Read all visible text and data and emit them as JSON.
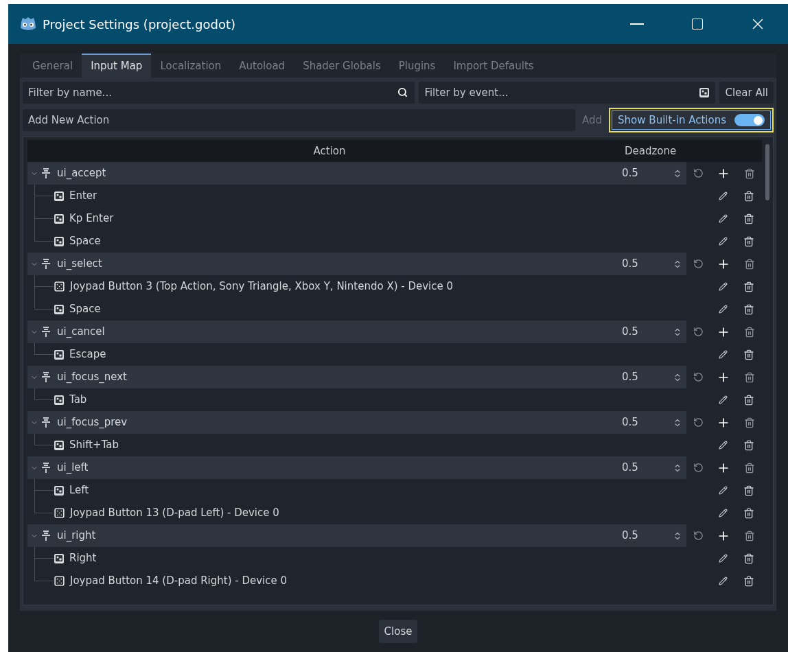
{
  "window": {
    "title": "Project Settings (project.godot)"
  },
  "tabs": [
    {
      "label": "General",
      "selected": false
    },
    {
      "label": "Input Map",
      "selected": true
    },
    {
      "label": "Localization",
      "selected": false
    },
    {
      "label": "Autoload",
      "selected": false
    },
    {
      "label": "Shader Globals",
      "selected": false
    },
    {
      "label": "Plugins",
      "selected": false
    },
    {
      "label": "Import Defaults",
      "selected": false
    }
  ],
  "filter_name": {
    "placeholder": "Filter by name..."
  },
  "filter_event": {
    "placeholder": "Filter by event..."
  },
  "clear_all": "Clear All",
  "add_action": {
    "placeholder": "Add New Action",
    "button": "Add",
    "button_disabled": true
  },
  "show_builtin": {
    "label": "Show Built-in Actions",
    "on": true
  },
  "table": {
    "columns": [
      "Action",
      "Deadzone"
    ],
    "actions": [
      {
        "name": "ui_accept",
        "deadzone": "0.5",
        "expanded": true,
        "events": [
          {
            "kind": "key",
            "label": "Enter"
          },
          {
            "kind": "key",
            "label": "Kp Enter"
          },
          {
            "kind": "key",
            "label": "Space"
          }
        ]
      },
      {
        "name": "ui_select",
        "deadzone": "0.5",
        "expanded": true,
        "events": [
          {
            "kind": "joypad",
            "label": "Joypad Button 3 (Top Action, Sony Triangle, Xbox Y, Nintendo X) - Device 0"
          },
          {
            "kind": "key",
            "label": "Space"
          }
        ]
      },
      {
        "name": "ui_cancel",
        "deadzone": "0.5",
        "expanded": true,
        "events": [
          {
            "kind": "key",
            "label": "Escape"
          }
        ]
      },
      {
        "name": "ui_focus_next",
        "deadzone": "0.5",
        "expanded": true,
        "events": [
          {
            "kind": "key",
            "label": "Tab"
          }
        ]
      },
      {
        "name": "ui_focus_prev",
        "deadzone": "0.5",
        "expanded": true,
        "events": [
          {
            "kind": "key",
            "label": "Shift+Tab"
          }
        ]
      },
      {
        "name": "ui_left",
        "deadzone": "0.5",
        "expanded": true,
        "events": [
          {
            "kind": "key",
            "label": "Left"
          },
          {
            "kind": "joypad",
            "label": "Joypad Button 13 (D-pad Left) - Device 0"
          }
        ]
      },
      {
        "name": "ui_right",
        "deadzone": "0.5",
        "expanded": true,
        "events": [
          {
            "kind": "key",
            "label": "Right"
          },
          {
            "kind": "joypad",
            "label": "Joypad Button 14 (D-pad Right) - Device 0"
          }
        ]
      }
    ]
  },
  "close_button": "Close"
}
